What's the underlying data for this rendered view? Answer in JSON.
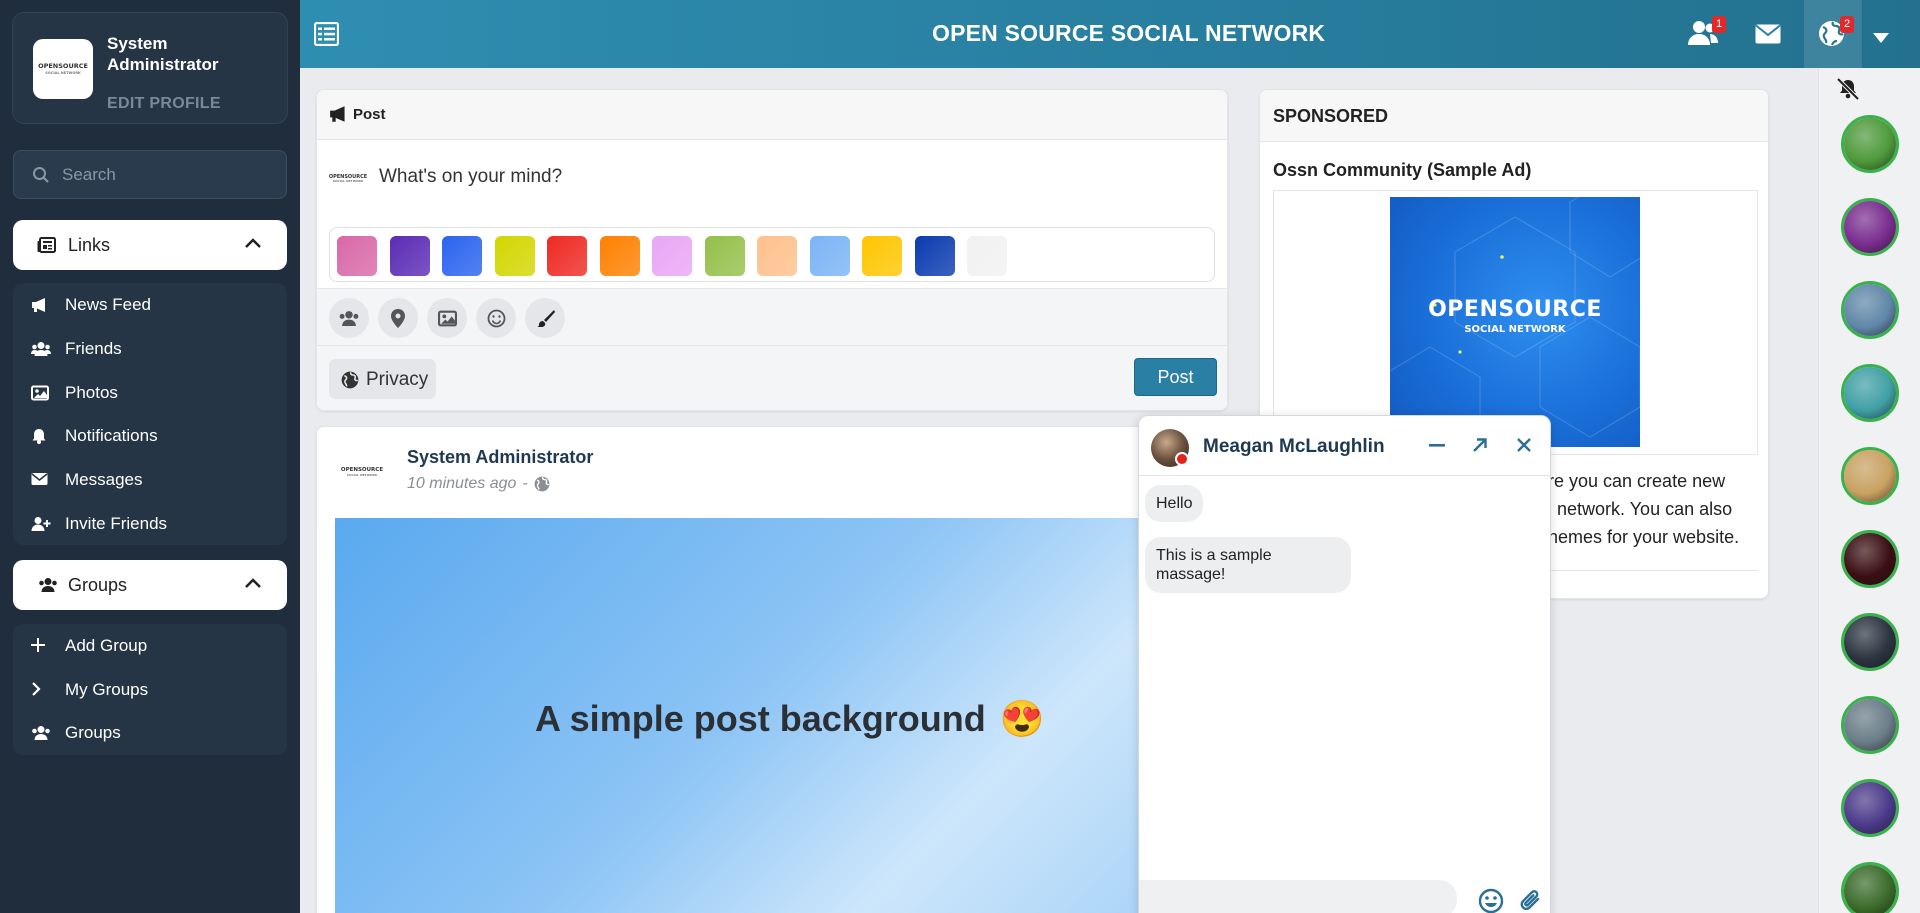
{
  "profile": {
    "name": "System Administrator",
    "edit_label": "EDIT PROFILE",
    "logo_text": "OPENSOURCE",
    "logo_subtext": "SOCIAL NETWORK"
  },
  "search": {
    "placeholder": "Search"
  },
  "links_section": {
    "label": "Links",
    "items": [
      {
        "label": "News Feed",
        "icon": "bullhorn-icon"
      },
      {
        "label": "Friends",
        "icon": "users-icon"
      },
      {
        "label": "Photos",
        "icon": "image-icon"
      },
      {
        "label": "Notifications",
        "icon": "bell-icon"
      },
      {
        "label": "Messages",
        "icon": "envelope-icon"
      },
      {
        "label": "Invite Friends",
        "icon": "user-plus-icon"
      }
    ]
  },
  "groups_section": {
    "label": "Groups",
    "items": [
      {
        "label": "Add Group",
        "icon": "plus-icon"
      },
      {
        "label": "My Groups",
        "icon": "chevron-right-icon"
      },
      {
        "label": "Groups",
        "icon": "users-icon"
      }
    ]
  },
  "topbar": {
    "title": "OPEN SOURCE SOCIAL NETWORK",
    "friend_requests_count": "1",
    "notifications_count": "2"
  },
  "composer": {
    "header": "Post",
    "placeholder": "What's on your mind?",
    "privacy_label": "Privacy",
    "post_button": "Post",
    "backgrounds": [
      "#d868a8",
      "#5b2bb5",
      "#2a63f0",
      "#d2d600",
      "#ee2a22",
      "#ff8000",
      "#e9a6f5",
      "#93c04a",
      "#ffc08c",
      "#7ab4f5",
      "#ffc500",
      "#0a3bb0",
      "#f1f1f1"
    ]
  },
  "feed_post": {
    "author": "System Administrator",
    "time": "10 minutes ago",
    "separator": "-",
    "text": "A simple post background",
    "emoji": "😍"
  },
  "sponsored": {
    "header": "SPONSORED",
    "title": "Ossn Community (Sample Ad)",
    "logo_main": "OPENSOURCE",
    "logo_sub": "SOCIAL NETWORK",
    "description_lines": [
      "re you can create new",
      "l network. You can also",
      "hemes for your website."
    ]
  },
  "chat": {
    "name": "Meagan McLaughlin",
    "messages": [
      "Hello",
      "This is a sample massage!"
    ]
  },
  "rail": {
    "avatar_colors": [
      "#4f9a3b",
      "#7a2d8f",
      "#5f87a8",
      "#3fa0a5",
      "#c9a261",
      "#3a0f12",
      "#2b3440",
      "#6a7d88",
      "#4b3a8a",
      "#3b6b2a"
    ]
  }
}
